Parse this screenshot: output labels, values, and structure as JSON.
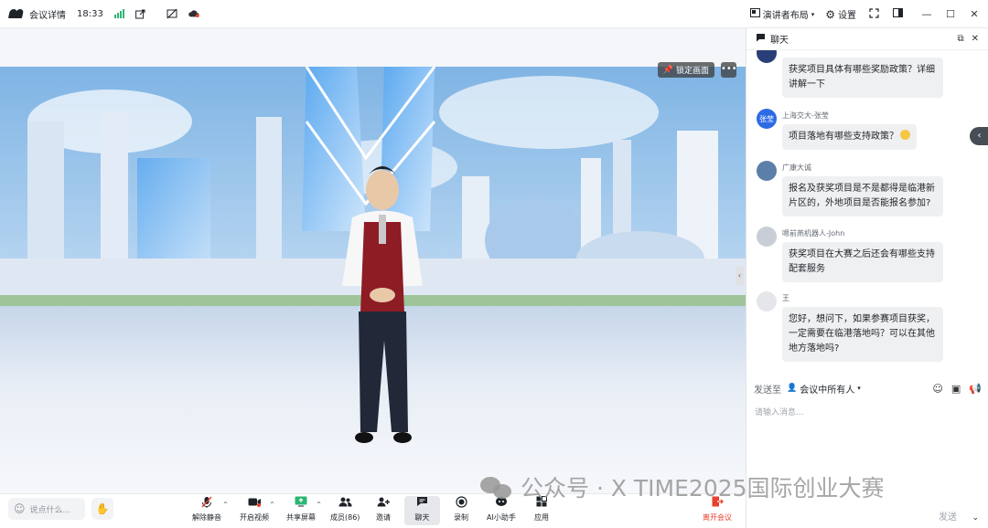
{
  "titlebar": {
    "title": "会议详情",
    "time": "18:33",
    "layout_label": "演讲者布局",
    "settings_label": "设置"
  },
  "video": {
    "lock_label": "锁定画面"
  },
  "chat": {
    "title": "聊天",
    "messages": [
      {
        "sender": "",
        "text": "获奖项目具体有哪些奖励政策？详细讲解一下",
        "avatar_text": ""
      },
      {
        "sender": "上海交大-张莹",
        "text": "项目落地有哪些支持政策？",
        "avatar_text": "张莹"
      },
      {
        "sender": "广康大诚",
        "text": "报名及获奖项目是不是都得是临港新片区的，外地项目是否能报名参加?",
        "avatar_text": ""
      },
      {
        "sender": "嗯前燕机器人-John",
        "text": "获奖项目在大赛之后还会有哪些支持配套服务",
        "avatar_text": ""
      },
      {
        "sender": "王",
        "text": "您好，想问下，如果参赛项目获奖，一定需要在临港落地吗？可以在其他地方落地吗?",
        "avatar_text": ""
      }
    ],
    "send_to_label": "发送至",
    "send_target": "会议中所有人",
    "input_placeholder": "请输入消息...",
    "send_button": "发送"
  },
  "toolbar": {
    "say_placeholder": "说点什么...",
    "items": [
      {
        "label": "解除静音",
        "icon": "mic-muted-icon"
      },
      {
        "label": "开启视频",
        "icon": "camera-off-icon"
      },
      {
        "label": "共享屏幕",
        "icon": "share-screen-icon"
      },
      {
        "label": "成员(86)",
        "icon": "members-icon"
      },
      {
        "label": "邀请",
        "icon": "invite-icon"
      },
      {
        "label": "聊天",
        "icon": "chat-icon"
      },
      {
        "label": "录制",
        "icon": "record-icon"
      },
      {
        "label": "AI小助手",
        "icon": "ai-assistant-icon"
      },
      {
        "label": "应用",
        "icon": "apps-icon"
      },
      {
        "label": "离开会议",
        "icon": "leave-icon"
      }
    ]
  },
  "watermark": {
    "text": "公众号 · X TIME2025国际创业大赛"
  },
  "colors": {
    "accent_green": "#2bb673",
    "leave_red": "#e8412c",
    "chat_bubble": "#eff0f1"
  }
}
